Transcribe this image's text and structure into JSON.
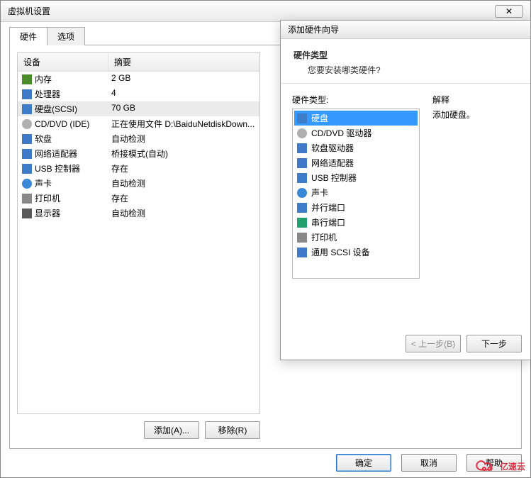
{
  "window": {
    "title": "虚拟机设置",
    "close_glyph": "✕"
  },
  "tabs": {
    "hardware": "硬件",
    "options": "选项"
  },
  "table": {
    "head_device": "设备",
    "head_summary": "摘要",
    "rows": [
      {
        "icon": "ic-mem",
        "name": "memory-icon",
        "device": "内存",
        "summary": "2 GB"
      },
      {
        "icon": "ic-cpu",
        "name": "cpu-icon",
        "device": "处理器",
        "summary": "4"
      },
      {
        "icon": "ic-hdd",
        "name": "hdd-icon",
        "device": "硬盘(SCSI)",
        "summary": "70 GB",
        "selected": true
      },
      {
        "icon": "ic-cd",
        "name": "cd-icon",
        "device": "CD/DVD (IDE)",
        "summary": "正在使用文件 D:\\BaiduNetdiskDown..."
      },
      {
        "icon": "ic-floppy",
        "name": "floppy-icon",
        "device": "软盘",
        "summary": "自动检测"
      },
      {
        "icon": "ic-net",
        "name": "network-icon",
        "device": "网络适配器",
        "summary": "桥接模式(自动)"
      },
      {
        "icon": "ic-usb",
        "name": "usb-icon",
        "device": "USB 控制器",
        "summary": "存在"
      },
      {
        "icon": "ic-snd",
        "name": "sound-icon",
        "device": "声卡",
        "summary": "自动检测"
      },
      {
        "icon": "ic-prn",
        "name": "printer-icon",
        "device": "打印机",
        "summary": "存在"
      },
      {
        "icon": "ic-disp",
        "name": "display-icon",
        "device": "显示器",
        "summary": "自动检测"
      }
    ]
  },
  "buttons": {
    "add": "添加(A)...",
    "remove": "移除(R)",
    "ok": "确定",
    "cancel": "取消",
    "help": "帮助"
  },
  "wizard": {
    "title": "添加硬件向导",
    "heading": "硬件类型",
    "subheading": "您要安装哪类硬件?",
    "list_label": "硬件类型:",
    "items": [
      {
        "icon": "ic-hdd",
        "name": "hdd-icon",
        "label": "硬盘",
        "selected": true
      },
      {
        "icon": "ic-cd",
        "name": "cd-icon",
        "label": "CD/DVD 驱动器"
      },
      {
        "icon": "ic-floppy",
        "name": "floppy-icon",
        "label": "软盘驱动器"
      },
      {
        "icon": "ic-net",
        "name": "network-icon",
        "label": "网络适配器"
      },
      {
        "icon": "ic-usb",
        "name": "usb-icon",
        "label": "USB 控制器"
      },
      {
        "icon": "ic-snd",
        "name": "sound-icon",
        "label": "声卡"
      },
      {
        "icon": "ic-para",
        "name": "parallel-icon",
        "label": "并行端口"
      },
      {
        "icon": "ic-ser",
        "name": "serial-icon",
        "label": "串行端口"
      },
      {
        "icon": "ic-prn",
        "name": "printer-icon",
        "label": "打印机"
      },
      {
        "icon": "ic-scsi",
        "name": "scsi-icon",
        "label": "通用 SCSI 设备"
      }
    ],
    "desc_label": "解释",
    "desc_text": "添加硬盘。",
    "back": "< 上一步(B)",
    "next": "下一步"
  },
  "logo": "亿速云"
}
